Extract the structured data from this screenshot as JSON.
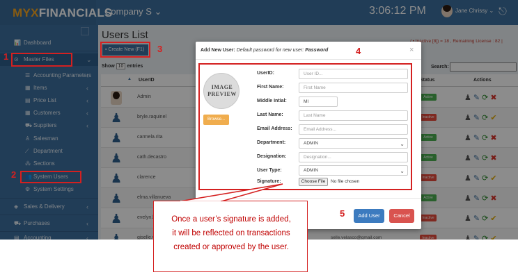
{
  "app": {
    "logo_prefix": "MYX",
    "logo_suffix": "FINANCIALS",
    "company": "Company S ⌄",
    "clock": "3:06:12 PM",
    "user": "Jane Chrissy ⌄"
  },
  "sidebar": {
    "items": [
      {
        "label": "Dashboard",
        "icon": "📊"
      },
      {
        "label": "Master Files",
        "icon": "⊙",
        "chev": "⌄"
      },
      {
        "label": "Accounting Parameters",
        "icon": "☰",
        "chev": "‹"
      },
      {
        "label": "Items",
        "icon": "▦",
        "chev": "‹"
      },
      {
        "label": "Price List",
        "icon": "▤",
        "chev": "‹"
      },
      {
        "label": "Customers",
        "icon": "▦",
        "chev": "‹"
      },
      {
        "label": "Suppliers",
        "icon": "⛟",
        "chev": "‹"
      },
      {
        "label": "Salesman",
        "icon": "♙"
      },
      {
        "label": "Department",
        "icon": "⟋"
      },
      {
        "label": "Sections",
        "icon": "⁂"
      },
      {
        "label": "System Users",
        "icon": "👥"
      },
      {
        "label": "System Settings",
        "icon": "⚙"
      },
      {
        "label": "Sales & Delivery",
        "icon": "◈",
        "chev": "‹"
      },
      {
        "label": "Purchases",
        "icon": "⛟",
        "chev": "‹"
      },
      {
        "label": "Accounting",
        "icon": "▤",
        "chev": "‹"
      }
    ]
  },
  "page": {
    "title": "Users List",
    "create_button": "Create New (F1)",
    "show_label": "Show",
    "show_value": "10",
    "show_suffix": "entries",
    "license": "/ • Inactive [8]) = 18 , Remaining License : 82 |",
    "search_label": "Search:"
  },
  "table": {
    "headers": {
      "user": "UserID",
      "status": "Status",
      "actions": "Actions"
    },
    "rows": [
      {
        "user": "Admin",
        "avatar": "photo",
        "email": "",
        "status": "Active"
      },
      {
        "user": "bryle.raquinel",
        "avatar": "silhouette",
        "email": "",
        "status": "Inactive"
      },
      {
        "user": "carmela.rita",
        "avatar": "silhouette",
        "email": "",
        "status": "Active"
      },
      {
        "user": "cath.decastro",
        "avatar": "silhouette",
        "email": "",
        "status": "Active"
      },
      {
        "user": "clarence",
        "avatar": "silhouette",
        "email": "",
        "status": "Inactive"
      },
      {
        "user": "elma.villanueva",
        "avatar": "silhouette",
        "email": "",
        "status": "Active"
      },
      {
        "user": "evelyn.bo",
        "avatar": "silhouette",
        "email": "",
        "status": "Inactive"
      },
      {
        "user": "giselle.ve",
        "avatar": "silhouette",
        "email": "selle.velasco@gmail.com",
        "status": "Inactive"
      }
    ]
  },
  "modal": {
    "title_bold": "Add New User:",
    "title_rest": " Default password for new user: ",
    "title_password": "Password",
    "close": "×",
    "image_preview": "IMAGE PREVIEW",
    "browse": "Browse...",
    "fields": [
      {
        "label": "UserID:",
        "placeholder": "User ID..."
      },
      {
        "label": "First Name:",
        "placeholder": "First Name"
      },
      {
        "label": "Middle Intial:",
        "value": "MI"
      },
      {
        "label": "Last Name:",
        "placeholder": "Last Name"
      },
      {
        "label": "Email Address:",
        "placeholder": "Email Address..."
      },
      {
        "label": "Department:",
        "value": "ADMIN"
      },
      {
        "label": "Designation:",
        "placeholder": "Designation..."
      },
      {
        "label": "User Type:",
        "value": "ADMIN"
      },
      {
        "label": "Signature:"
      }
    ],
    "file_button": "Choose File",
    "file_status": "No file chosen",
    "add_button": "Add User",
    "cancel_button": "Cancel"
  },
  "annotations": {
    "n1": "1",
    "n2": "2",
    "n3": "3",
    "n4": "4",
    "n5": "5",
    "accent": "#d42020",
    "callout_line1": "Once a user’s signature is added,",
    "callout_line2": "it will be reflected on transactions",
    "callout_line3": "created or approved by the user."
  }
}
